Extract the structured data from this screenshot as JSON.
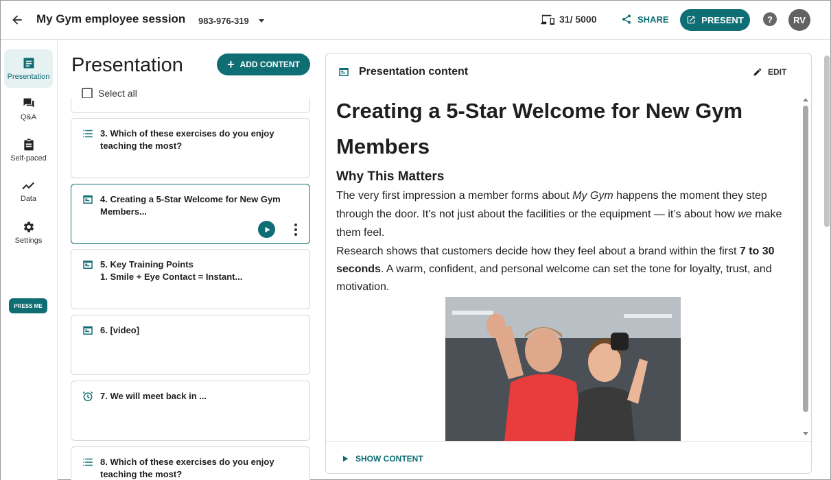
{
  "header": {
    "title": "My Gym employee session",
    "session_code": "983-976-319",
    "devices_count": "31/ 5000",
    "share_label": "SHARE",
    "present_label": "PRESENT",
    "help_label": "?",
    "avatar_initials": "RV"
  },
  "nav": {
    "items": [
      {
        "label": "Presentation",
        "icon": "presentation-icon",
        "active": true
      },
      {
        "label": "Q&A",
        "icon": "chat-icon"
      },
      {
        "label": "Self-paced",
        "icon": "clipboard-icon"
      },
      {
        "label": "Data",
        "icon": "chart-line-icon"
      },
      {
        "label": "Settings",
        "icon": "gear-icon"
      }
    ],
    "press_me_label": "PRESS ME"
  },
  "list": {
    "title": "Presentation",
    "add_content_label": "ADD CONTENT",
    "select_all_label": "Select all",
    "cards": [
      {
        "text": "3. Which of these exercises do you enjoy teaching the most?",
        "icon": "list-icon"
      },
      {
        "text": "4. Creating a 5-Star Welcome for New Gym Members...",
        "icon": "slide-icon",
        "selected": true
      },
      {
        "text": "5. Key Training Points\n1. Smile + Eye Contact = Instant...",
        "icon": "slide-icon"
      },
      {
        "text": "6. [video]",
        "icon": "slide-icon"
      },
      {
        "text": "7. We will meet back in ...",
        "icon": "alarm-icon"
      },
      {
        "text": "8. Which of these exercises do you enjoy teaching the most?",
        "icon": "list-icon"
      }
    ]
  },
  "panel": {
    "title": "Presentation content",
    "edit_label": "EDIT",
    "heading": "Creating a 5-Star Welcome for New Gym Members",
    "subheading": "Why This Matters",
    "p1_a": "The very first impression a member forms about ",
    "p1_em1": "My Gym",
    "p1_b": " happens the moment they step through the door. It's not just about the facilities or the equipment — it’s about how ",
    "p1_em2": "we",
    "p1_c": " make them feel.",
    "p2_a": "Research shows that customers decide how they feel about a brand within the first ",
    "p2_strong": "7 to 30 seconds",
    "p2_b": ". A warm, confident, and personal welcome can set the tone for loyalty, trust, and motivation.",
    "show_content_label": "SHOW CONTENT"
  },
  "colors": {
    "accent": "#0e6e74",
    "nav_active_bg": "#e6f1f2"
  }
}
